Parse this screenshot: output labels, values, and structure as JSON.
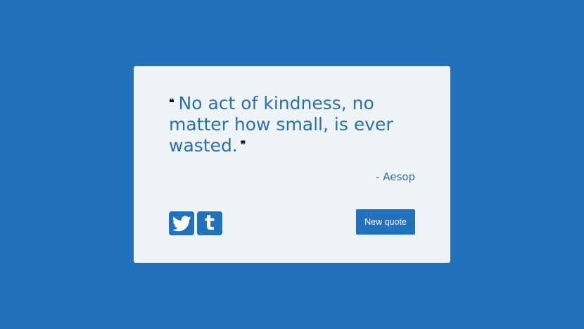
{
  "quote": {
    "text": "No act of kindness, no matter how small, is ever wasted.",
    "open_mark": "❝",
    "close_mark": "❞",
    "author": "- Aesop"
  },
  "actions": {
    "twitter_icon": "twitter-icon",
    "tumblr_icon": "tumblr-icon",
    "tumblr_glyph": "t",
    "new_quote_label": "New quote"
  },
  "colors": {
    "background": "#2171bc",
    "card": "#eef3f5",
    "accent": "#2a6fb0",
    "button": "#2171bc"
  }
}
